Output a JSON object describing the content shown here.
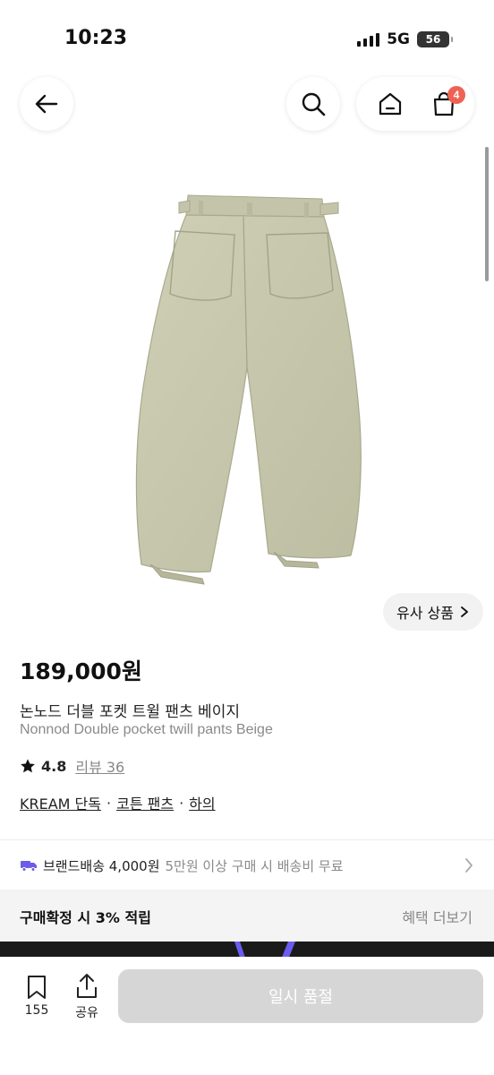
{
  "status_bar": {
    "time": "10:23",
    "network": "5G",
    "battery": "56"
  },
  "header": {
    "cart_count": "4"
  },
  "similar_button": {
    "label": "유사 상품"
  },
  "product": {
    "price": "189,000원",
    "name_ko": "논노드 더블 포켓 트윌 팬츠 베이지",
    "name_en": "Nonnod Double pocket twill pants Beige",
    "rating": "4.8",
    "review_label": "리뷰 36",
    "image_color": "#c9c9b0"
  },
  "tags": [
    "KREAM 단독",
    "코튼 팬츠",
    "하의"
  ],
  "shipping": {
    "label": "브랜드배송 4,000원",
    "note": "5만원 이상 구매 시 배송비 무료",
    "icon": "truck-icon"
  },
  "benefit": {
    "label": "구매확정 시 3% 적립",
    "link": "혜택 더보기"
  },
  "bottom_bar": {
    "save_count": "155",
    "share_label": "공유",
    "buy_label": "일시 품절"
  },
  "colors": {
    "badge": "#ef6253",
    "truck": "#6c5ce7",
    "disabled_button": "#d6d6d6"
  }
}
